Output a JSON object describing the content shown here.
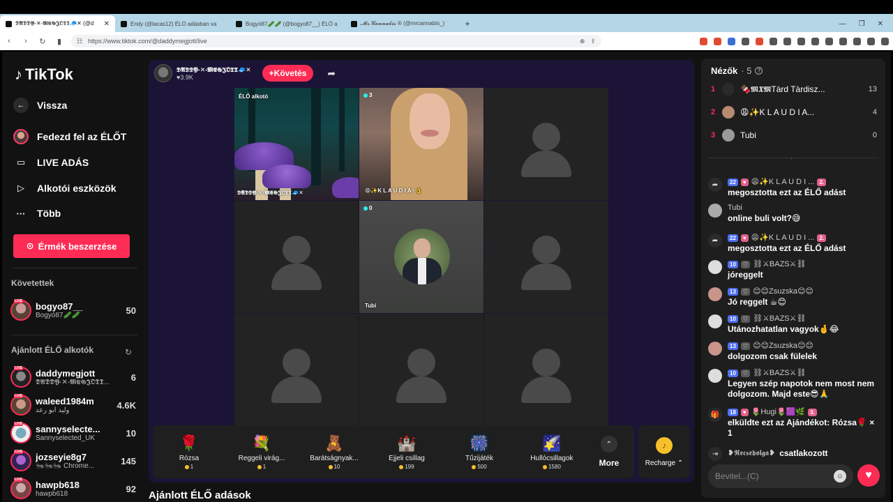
{
  "browser": {
    "tabs": [
      {
        "label": "𝕯𝕬𝕯𝕯𝖄-✕-𝕸𝕰𝕲𝕵𝕺𝕿𝕿🧢✕ (@d"
      },
      {
        "label": "Endy (@lacas12) ÉLŐ adásban va"
      },
      {
        "label": "Bogyó87🥒🥒 (@bogyo87__) ÉLŐ a"
      },
      {
        "label": "𝓜𝓻.𝓒𝓪𝓷𝓷𝓪𝓫𝓲𝓼 ® (@mrcannabis_)"
      }
    ],
    "url": "https://www.tiktok.com/@daddymegjott/live"
  },
  "sidebar": {
    "logo": "TikTok",
    "nav": [
      {
        "label": "Vissza",
        "icon": "back-arrow-icon"
      },
      {
        "label": "Fedezd fel az ÉLŐT",
        "icon": "avatar-icon"
      },
      {
        "label": "LIVE ADÁS",
        "icon": "video-camera-icon"
      },
      {
        "label": "Alkotói eszközök",
        "icon": "creator-tools-icon"
      },
      {
        "label": "Több",
        "icon": "more-dots-icon"
      }
    ],
    "coin_button": "Érmék beszerzése",
    "following_title": "Követettek",
    "following": [
      {
        "name": "bogyo87__",
        "sub": "Bogyó87🥒🥒",
        "count": "50"
      }
    ],
    "recommended_title": "Ajánlott ÉLŐ alkotók",
    "recommended": [
      {
        "name": "daddymegjott",
        "sub": "𝕯𝕬𝕯𝕯𝖄-✕-𝕸𝕰𝕲𝕵𝕺𝕿𝕿...",
        "count": "6"
      },
      {
        "name": "waleed1984m",
        "sub": "وليد ابو رعد",
        "count": "4.6K"
      },
      {
        "name": "sannyselecte...",
        "sub": "Sannyselected_UK",
        "count": "10"
      },
      {
        "name": "jozseyie8g7",
        "sub": "🐜🐜🐜 Chrome...",
        "count": "145"
      },
      {
        "name": "hawpb618",
        "sub": "hawpb618",
        "count": "92"
      }
    ]
  },
  "stream": {
    "host_name": "𝕯𝕬𝕯𝕯𝖄-✕-𝕸𝕰𝕲𝕵𝕺𝕿𝕿🧢✕",
    "host_likes": "♥3.9K",
    "follow_label": "+Követés",
    "cells": [
      {
        "type": "forest",
        "top_label": "ÉLŐ alkotó",
        "bottom_label": "𝕯𝕬𝕯𝕯𝖄-✕-𝕸𝕰𝕲𝕵𝕺𝕿𝕿🧢✕"
      },
      {
        "type": "woman",
        "viewers": "3",
        "bottom_label": "😩✨K L A U D I A⚡👌"
      },
      {
        "type": "empty"
      },
      {
        "type": "empty"
      },
      {
        "type": "man",
        "viewers": "0",
        "bottom_label": "Tubi"
      },
      {
        "type": "empty"
      },
      {
        "type": "empty"
      },
      {
        "type": "empty"
      },
      {
        "type": "empty"
      }
    ],
    "gifts": [
      {
        "name": "Rózsa",
        "price": "1",
        "icon": "🌹"
      },
      {
        "name": "Reggeli virág...",
        "price": "1",
        "icon": "💐"
      },
      {
        "name": "Barátságnyak...",
        "price": "10",
        "icon": "🧸"
      },
      {
        "name": "Éjjeli csillag",
        "price": "199",
        "icon": "🏰"
      },
      {
        "name": "Tűzijáték",
        "price": "500",
        "icon": "🎆"
      },
      {
        "name": "Hullócsillagok",
        "price": "1580",
        "icon": "🌠"
      }
    ],
    "more_label": "More",
    "recharge_label": "Recharge ⌃",
    "recommended_heading": "Ajánlott ÉLŐ adások"
  },
  "chat": {
    "viewers_label": "Nézők",
    "viewers_count": "· 5",
    "top_viewers": [
      {
        "rank": "1",
        "name": "🍫𝕸𝖃𝕸Tàrd Tàrdisz...",
        "score": "13"
      },
      {
        "rank": "2",
        "name": "😩✨K L A U D I A...",
        "score": "4"
      },
      {
        "rank": "3",
        "name": "Tubi",
        "score": "0"
      }
    ],
    "messages": [
      {
        "kind": "share",
        "badges": [
          "22",
          "♥",
          "😩✨K L A U D I ...",
          "2."
        ],
        "text": "megosztotta ezt az ÉLŐ adást"
      },
      {
        "kind": "plain",
        "user": "Tubi",
        "text": "online buli volt?😅"
      },
      {
        "kind": "share",
        "badges": [
          "22",
          "♥",
          "😩✨K L A U D I ...",
          "2."
        ],
        "text": "megosztotta ezt az ÉLŐ adást"
      },
      {
        "kind": "plain",
        "badges": [
          "10",
          "♡"
        ],
        "user": "⛓⚔BAZS⚔⛓",
        "text": "jóreggelt"
      },
      {
        "kind": "plain",
        "badges": [
          "13",
          "♡"
        ],
        "user": "😊😊Zsuzska😊😊",
        "text": "Jó reggelt ☕😊"
      },
      {
        "kind": "plain",
        "badges": [
          "10",
          "♡"
        ],
        "user": "⛓⚔BAZS⚔⛓",
        "text": "Utánozhatatlan vagyok🤞😂"
      },
      {
        "kind": "plain",
        "badges": [
          "13",
          "♡"
        ],
        "user": "😊😊Zsuzska😊😊",
        "text": "dolgozom csak fülelek"
      },
      {
        "kind": "plain",
        "badges": [
          "10",
          "♡"
        ],
        "user": "⛓⚔BAZS⚔⛓",
        "text": "Legyen szép napotok nem most nem dolgozom. Majd este😎🙏"
      },
      {
        "kind": "gift",
        "badges": [
          "18",
          "♥"
        ],
        "user": "🌷Hugi🌷🟪🌿",
        "rank": "3.",
        "text": "elküldte ezt az Ajándékot: Rózsa🌹 × 1"
      },
      {
        "kind": "join",
        "user": "❥𝕽𝖊𝖈𝖘𝖊𝖇𝖔𝖑𝖌𝖆❥",
        "text": "csatlakozott"
      }
    ],
    "input_placeholder": "Bevitel...(C)"
  }
}
